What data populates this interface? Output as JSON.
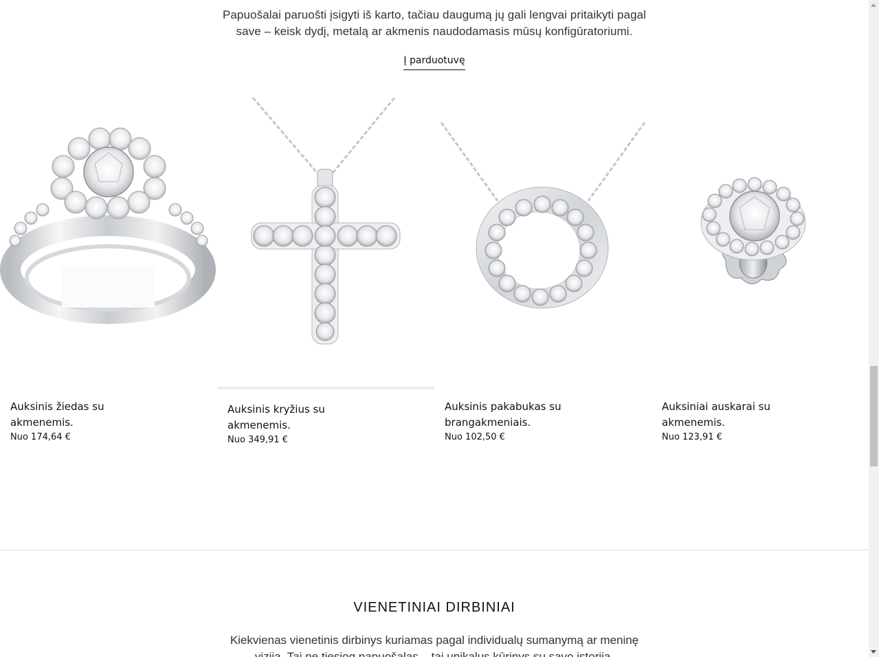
{
  "intro": {
    "text": "Papuošalai paruošti įsigyti iš karto, tačiau daugumą jų gali lengvai pritaikyti pagal save – keisk dydį, metalą ar akmenis naudodamasis mūsų konfigūratoriumi.",
    "shop_link": "Į parduotuvę"
  },
  "products": [
    {
      "name": "Auksinis žiedas su akmenemis.",
      "price": "Nuo 174,64 €",
      "image": "ring-icon"
    },
    {
      "name": "Auksinis kryžius su akmenemis.",
      "price": "Nuo 349,91 €",
      "image": "cross-pendant-icon"
    },
    {
      "name": "Auksinis pakabukas su brangakmeniais.",
      "price": "Nuo 102,50 €",
      "image": "circle-pendant-icon"
    },
    {
      "name": "Auksiniai auskarai su akmenemis.",
      "price": "Nuo 123,91 €",
      "image": "stud-earring-icon"
    }
  ],
  "section2": {
    "title": "VIENETINIAI DIRBINIAI",
    "text": "Kiekvienas vienetinis dirbinys kuriamas pagal individualų sumanymą ar meninę viziją. Tai ne tiesiog papuošalas – tai unikalus kūrinys su savo istorija, charakteriu"
  },
  "colors": {
    "metal": "#d9dbde",
    "metal_dark": "#9a9da2",
    "diamond": "#f4f5f7",
    "divider": "#dcdcdc"
  }
}
